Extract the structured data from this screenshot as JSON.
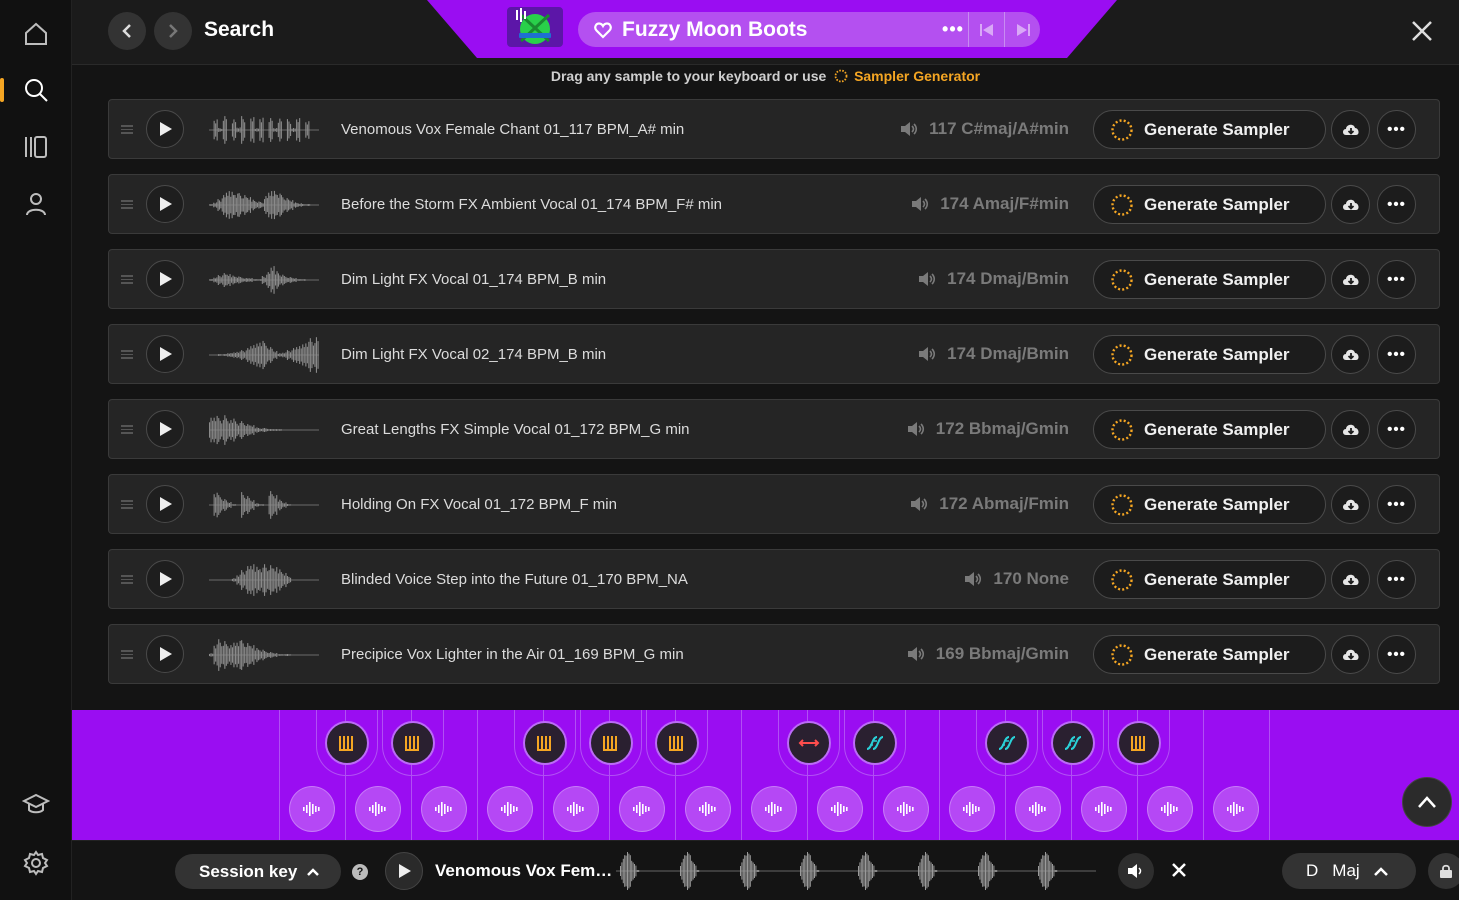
{
  "rail": {
    "items": [
      {
        "icon": "home-icon"
      },
      {
        "icon": "search-icon",
        "active": true
      },
      {
        "icon": "library-icon"
      },
      {
        "icon": "user-icon"
      },
      {
        "icon": "learn-icon"
      },
      {
        "icon": "gear-icon"
      }
    ],
    "accent": "#f5a623"
  },
  "header": {
    "title": "Search",
    "pack_name": "Fuzzy Moon Boots",
    "pack_more": "•••",
    "banner_color": "#9a0df2"
  },
  "hint": {
    "text": "Drag any sample to your keyboard or use",
    "link": "Sampler Generator"
  },
  "samples": [
    {
      "name": "Venomous Vox Female Chant 01_117 BPM_A# min",
      "meta": "117 C#maj/A#min",
      "wave": "pulses"
    },
    {
      "name": "Before the Storm FX Ambient Vocal 01_174 BPM_F# min",
      "meta": "174 Amaj/F#min",
      "wave": "swell"
    },
    {
      "name": "Dim Light FX Vocal 01_174 BPM_B min",
      "meta": "174 Dmaj/Bmin",
      "wave": "spike"
    },
    {
      "name": "Dim Light FX Vocal 02_174 BPM_B min",
      "meta": "174 Dmaj/Bmin",
      "wave": "rise"
    },
    {
      "name": "Great Lengths FX Simple Vocal 01_172 BPM_G min",
      "meta": "172 Bbmaj/Gmin",
      "wave": "front"
    },
    {
      "name": "Holding On FX Vocal 01_172 BPM_F min",
      "meta": "172 Abmaj/Fmin",
      "wave": "triple"
    },
    {
      "name": "Blinded Voice Step into the Future 01_170 BPM_NA",
      "meta": "170 None",
      "wave": "block"
    },
    {
      "name": "Precipice Vox Lighter in the Air 01_169 BPM_G min",
      "meta": "169 Bbmaj/Gmin",
      "wave": "front2"
    }
  ],
  "generate_label": "Generate Sampler",
  "more_label": "•••",
  "player": {
    "session_label": "Session key",
    "help": "?",
    "title": "Venomous Vox Femal...",
    "key_note": "D",
    "key_mode": "Maj"
  },
  "colors": {
    "keyboard": "#9a0df2",
    "slot_orange": "#f5a623",
    "slot_teal": "#2ad1d8",
    "slot_red": "#ff4d4d"
  }
}
